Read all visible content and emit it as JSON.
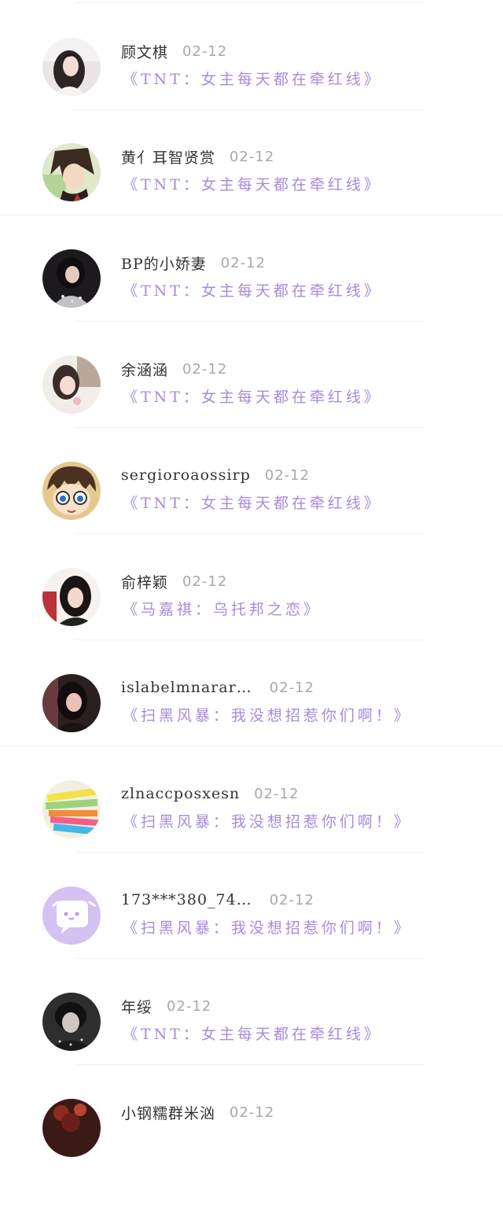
{
  "records": [
    {
      "name": "顾文棋",
      "date": "02-12",
      "book": "《TNT：女主每天都在牵红线》",
      "avatar": "user-photo-avatar"
    },
    {
      "name": "黄亻耳智贤赏",
      "date": "02-12",
      "book": "《TNT：女主每天都在牵红线》",
      "avatar": "anime-avatar"
    },
    {
      "name": "BP的小娇妻",
      "date": "02-12",
      "book": "《TNT：女主每天都在牵红线》",
      "avatar": "user-photo-avatar"
    },
    {
      "name": "余涵涵",
      "date": "02-12",
      "book": "《TNT：女主每天都在牵红线》",
      "avatar": "user-photo-avatar"
    },
    {
      "name": "sergioroaossirp",
      "date": "02-12",
      "book": "《TNT：女主每天都在牵红线》",
      "avatar": "anime-avatar"
    },
    {
      "name": "俞梓颖",
      "date": "02-12",
      "book": "《马嘉祺：乌托邦之恋》",
      "avatar": "user-photo-avatar"
    },
    {
      "name": "islabelmnarar…",
      "date": "02-12",
      "book": "《扫黑风暴：我没想招惹你们啊！》",
      "avatar": "user-photo-avatar"
    },
    {
      "name": "zlnaccposxesn",
      "date": "02-12",
      "book": "《扫黑风暴：我没想招惹你们啊！》",
      "avatar": "colorful-paper-avatar"
    },
    {
      "name": "173***380_74…",
      "date": "02-12",
      "book": "《扫黑风暴：我没想招惹你们啊！》",
      "avatar": "default-chat-avatar"
    },
    {
      "name": "年绥",
      "date": "02-12",
      "book": "《TNT：女主每天都在牵红线》",
      "avatar": "user-photo-avatar"
    },
    {
      "name": "小钢糯群米汹",
      "date": "02-12",
      "book": "",
      "avatar": "user-photo-avatar"
    }
  ],
  "colors": {
    "book_title": "#a98ad9",
    "default_avatar_bg": "#d4c2f3",
    "name": "#333333",
    "date": "#a8a8a8"
  }
}
